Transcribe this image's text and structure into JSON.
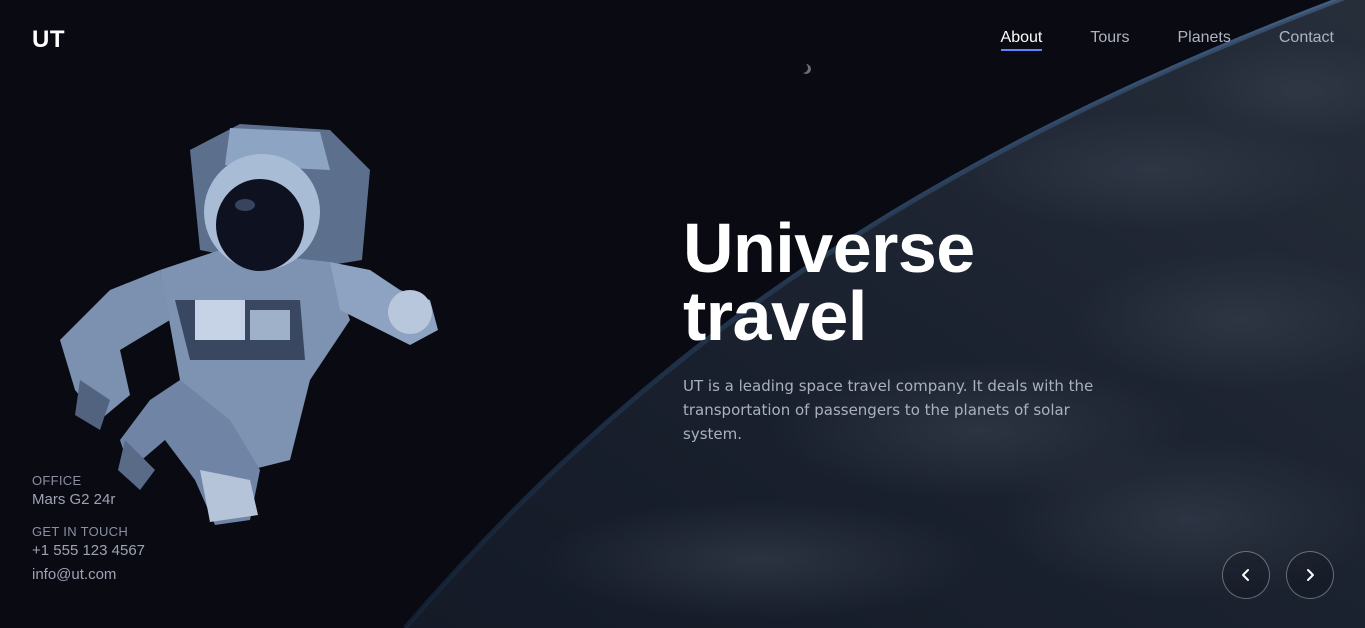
{
  "brand": {
    "logo": "UT"
  },
  "nav": {
    "items": [
      {
        "label": "About",
        "active": true
      },
      {
        "label": "Tours",
        "active": false
      },
      {
        "label": "Planets",
        "active": false
      },
      {
        "label": "Contact",
        "active": false
      }
    ]
  },
  "hero": {
    "title_line1": "Universe",
    "title_line2": "travel",
    "description": "UT is a leading space travel company. It deals with the transportation of passengers to the planets of solar system."
  },
  "contact": {
    "office_label": "OFFICE",
    "office_value": "Mars G2 24r",
    "touch_label": "GET IN TOUCH",
    "phone": "+1 555 123 4567",
    "email": "info@ut.com"
  },
  "slider": {
    "prev_icon": "chevron-left-icon",
    "next_icon": "chevron-right-icon"
  },
  "colors": {
    "background": "#090a12",
    "accent": "#5c86ff",
    "text_muted": "#aab0bf"
  }
}
